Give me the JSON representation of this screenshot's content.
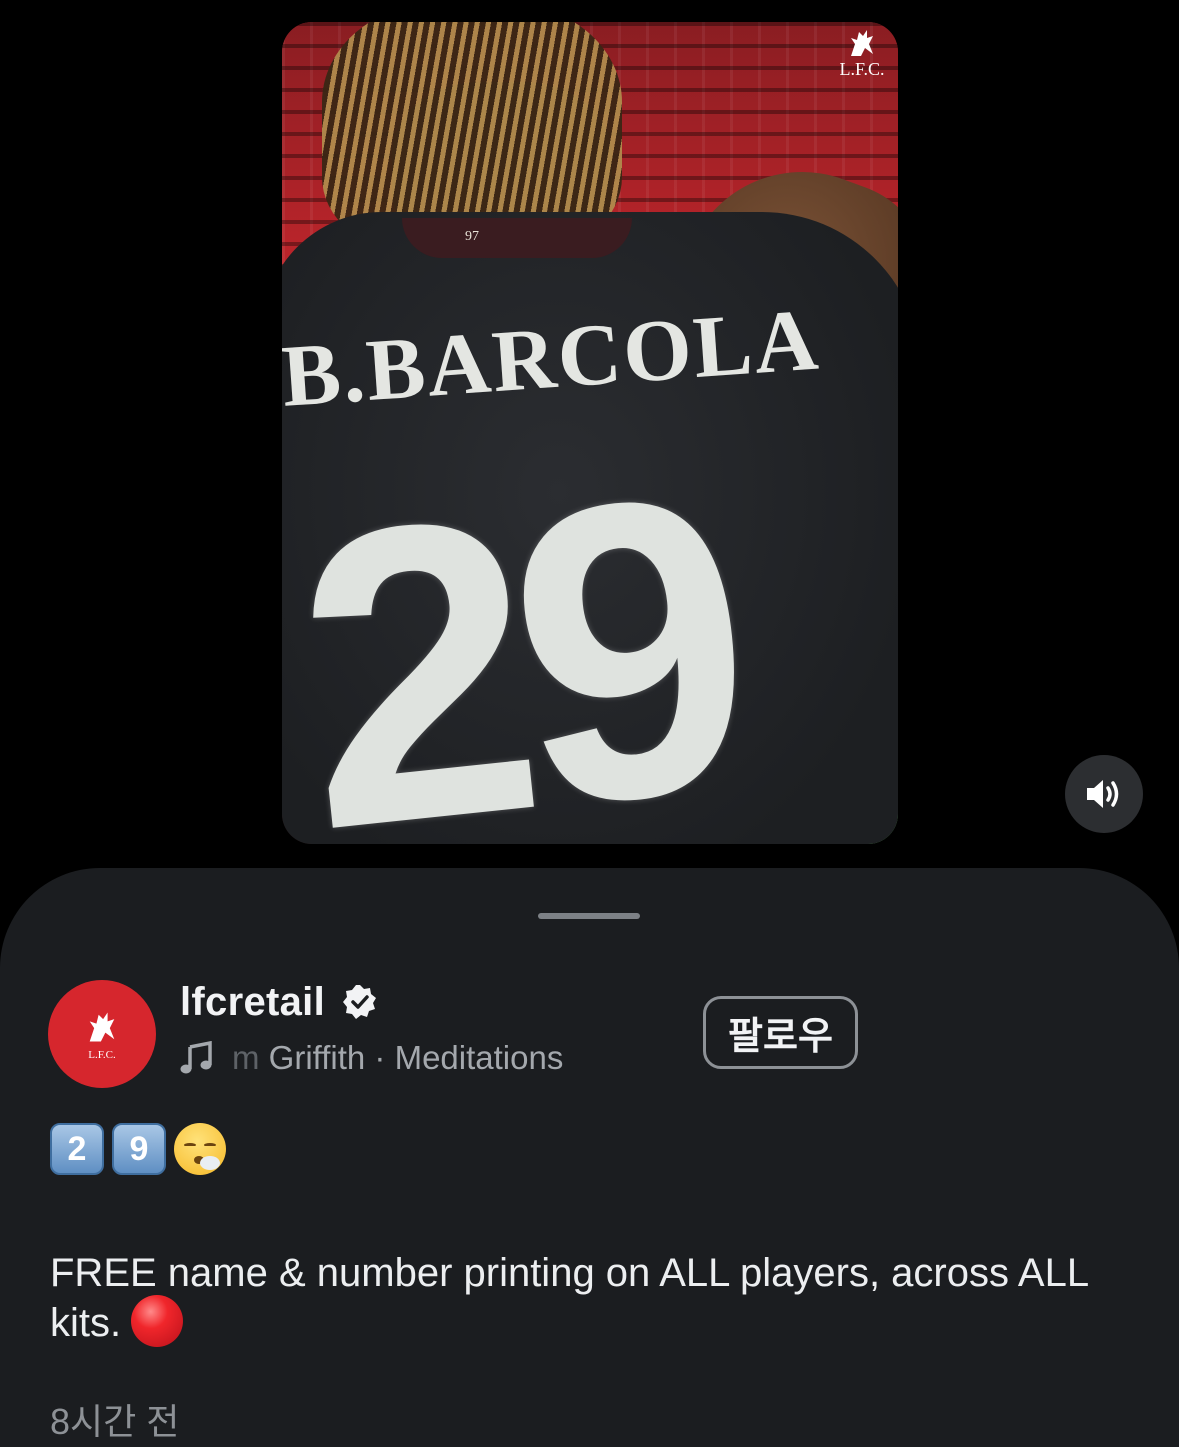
{
  "video": {
    "jersey_name": "B.BARCOLA",
    "jersey_number": "29",
    "collar_text": "97",
    "brand_logo_text": "L.F.C.",
    "sound_state": "on"
  },
  "post": {
    "username": "lfcretail",
    "verified": true,
    "avatar_text": "L.F.C.",
    "music_faded_prefix": "m",
    "music_text": " Griffith · Meditations",
    "follow_label": "팔로우",
    "emoji_keycap_1": "2",
    "emoji_keycap_2": "9",
    "caption": "FREE name & number printing on ALL players, across ALL kits.",
    "timestamp": "8시간 전"
  },
  "colors": {
    "sheet_bg": "#1b1d20",
    "brand_red": "#d6262d",
    "muted_text": "#8d9196"
  }
}
